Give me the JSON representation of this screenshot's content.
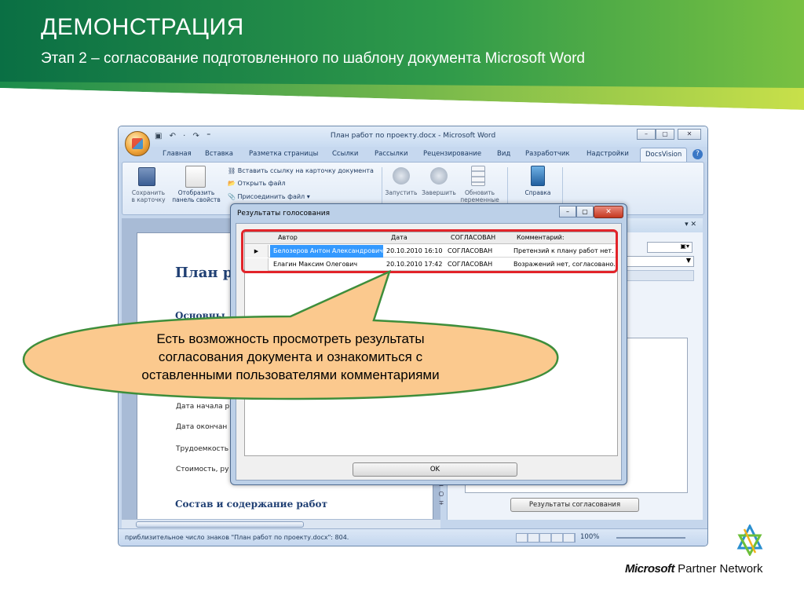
{
  "slide": {
    "title": "ДЕМОНСТРАЦИЯ",
    "subtitle": "Этап 2 – согласование подготовленного по шаблону документа Microsoft Word"
  },
  "colors": {
    "banner_dark": "#0f7a4c",
    "banner_light": "#8cc63f",
    "callout_fill": "#fbc98e",
    "callout_border": "#3e8e3b",
    "highlight": "#e2242a"
  },
  "word": {
    "title": "План работ по проекту.docx - Microsoft Word",
    "qat": "▣ ↶ · ↷ ⁼",
    "window_buttons": [
      "–",
      "▢",
      "✕"
    ],
    "tabs": [
      "Главная",
      "Вставка",
      "Разметка страницы",
      "Ссылки",
      "Рассылки",
      "Рецензирование",
      "Вид",
      "Разработчик",
      "Надстройки",
      "DocsVision"
    ],
    "help_icon": "?",
    "ribbon": {
      "save": "Сохранить\nв карточку",
      "show_panel": "Отобразить\nпанель свойств",
      "insert_link": "Вставить ссылку на карточку документа",
      "open_file": "Открыть файл",
      "attach_file": "Присоединить файл ▾",
      "start": "Запустить",
      "finish": "Завершить",
      "refresh": "Обновить\nпеременные",
      "help": "Справка"
    },
    "document": {
      "heading": "План р",
      "section": "Основны",
      "rows": [
        "Дата начала р",
        "Дата окончан",
        "Трудоемкость",
        "Стоимость, ру"
      ],
      "composition": "Состав и содержание работ"
    },
    "pane": {
      "close_controls": "▾ ✕",
      "results_button": "Результаты согласования"
    },
    "status": "приблизительное число знаков \"План работ по проекту.docx\": 804.",
    "zoom": "100%"
  },
  "dialog": {
    "title": "Результаты голосования",
    "columns": [
      "Автор",
      "Дата",
      "СОГЛАСОВАН",
      "Комментарий:"
    ],
    "rows": [
      {
        "author": "Белозеров Антон Александрович",
        "date": "20.10.2010 16:10",
        "status": "СОГЛАСОВАН",
        "comment": "Претензий к плану работ нет."
      },
      {
        "author": "Елагин Максим Олегович",
        "date": "20.10.2010 17:42",
        "status": "СОГЛАСОВАН",
        "comment": "Возражений нет, согласовано."
      }
    ],
    "ok": "OK"
  },
  "callout": {
    "line1": "Есть возможность просмотреть результаты",
    "line2": "согласования документа и ознакомиться с",
    "line3": "оставленными  пользователями комментариями"
  },
  "logo": {
    "brand": "Microsoft",
    "text": "Partner Network"
  }
}
